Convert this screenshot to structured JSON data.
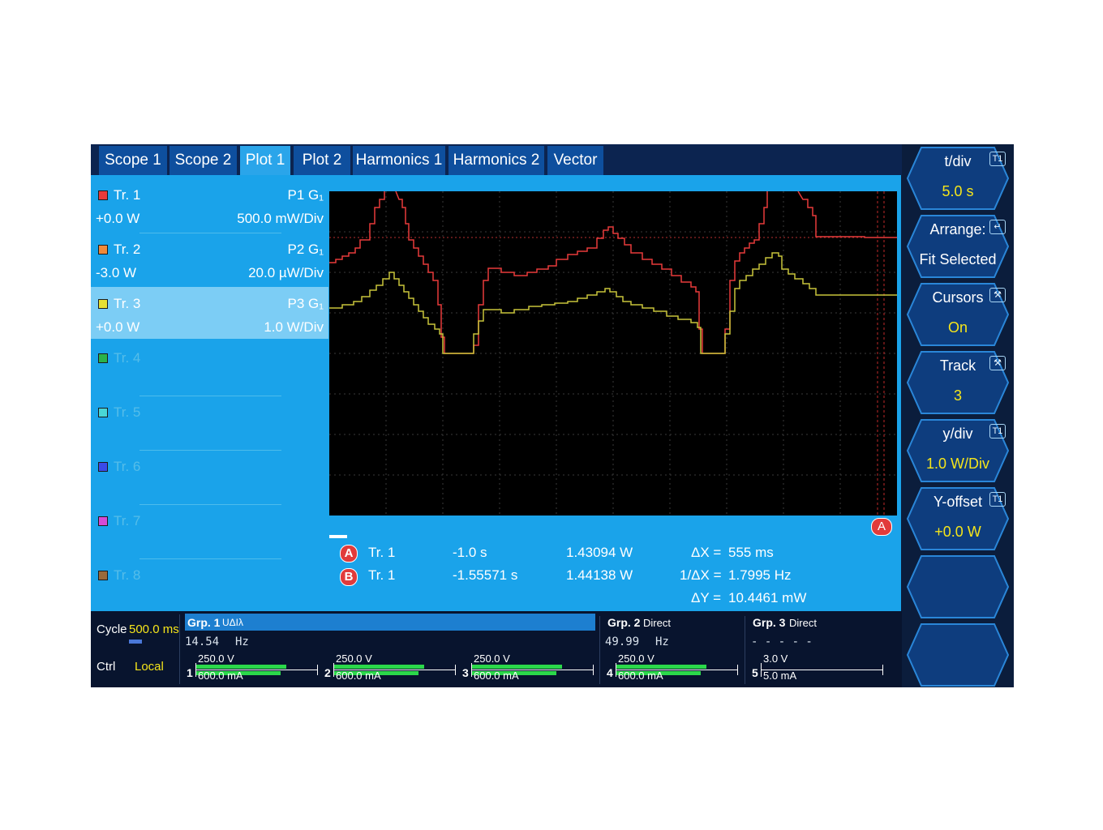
{
  "tabs": [
    "Scope 1",
    "Scope 2",
    "Plot 1",
    "Plot 2",
    "Harmonics 1",
    "Harmonics 2",
    "Vector"
  ],
  "active_tab": "Plot 1",
  "traces": [
    {
      "name": "Tr. 1",
      "color": "#e83a3a",
      "source": "P1 G₁",
      "value": "+0.0 W",
      "scale": "500.0 mW/Div"
    },
    {
      "name": "Tr. 2",
      "color": "#f08a3a",
      "source": "P2 G₁",
      "value": "-3.0 W",
      "scale": "20.0 µW/Div"
    },
    {
      "name": "Tr. 3",
      "color": "#e6e033",
      "source": "P3 G₁",
      "value": "+0.0 W",
      "scale": "1.0 W/Div"
    },
    {
      "name": "Tr. 4",
      "color": "#2ab24a"
    },
    {
      "name": "Tr. 5",
      "color": "#49d6d6"
    },
    {
      "name": "Tr. 6",
      "color": "#3a4be8"
    },
    {
      "name": "Tr. 7",
      "color": "#d64ad6"
    },
    {
      "name": "Tr. 8",
      "color": "#9a6a3a"
    }
  ],
  "cursors": {
    "rows": [
      {
        "marker": "A",
        "trace": "Tr. 1",
        "time": "-1.0 s",
        "value": "1.43094 W"
      },
      {
        "marker": "B",
        "trace": "Tr. 1",
        "time": "-1.55571 s",
        "value": "1.44138 W"
      }
    ],
    "dx_label": "ΔX =",
    "dx": "555 ms",
    "inv_dx_label": "1/ΔX =",
    "inv_dx": "1.7995 Hz",
    "dy_label": "ΔY =",
    "dy": "10.4461 mW",
    "plot_marker": "A"
  },
  "softkeys": [
    {
      "title": "t/div",
      "value": "5.0 s",
      "icon": "T1"
    },
    {
      "title": "Arrange:",
      "value": "Fit Selected",
      "icon": "enter"
    },
    {
      "title": "Cursors",
      "value": "On",
      "icon": "tools"
    },
    {
      "title": "Track",
      "value": "3",
      "icon": "tools"
    },
    {
      "title": "y/div",
      "value": "1.0 W/Div",
      "icon": "T1"
    },
    {
      "title": "Y-offset",
      "value": "+0.0 W",
      "icon": "T1"
    },
    {
      "title": "",
      "value": ""
    },
    {
      "title": "",
      "value": ""
    }
  ],
  "status": {
    "cycle_label": "Cycle",
    "cycle": "500.0 ms",
    "ctrl_label": "Ctrl",
    "ctrl": "Local",
    "groups": [
      {
        "label": "Grp. 1",
        "mode": "UΔIλ",
        "freq": "14.54",
        "unit": "Hz"
      },
      {
        "label": "Grp. 2",
        "mode": "Direct",
        "freq": "49.99",
        "unit": "Hz"
      },
      {
        "label": "Grp. 3",
        "mode": "Direct",
        "freq": "- - - - -"
      }
    ],
    "channels": [
      {
        "num": "1",
        "v": "250.0 V",
        "a": "600.0 mA",
        "fill1": 0.75,
        "fill2": 0.7
      },
      {
        "num": "2",
        "v": "250.0 V",
        "a": "600.0 mA",
        "fill1": 0.75,
        "fill2": 0.7
      },
      {
        "num": "3",
        "v": "250.0 V",
        "a": "600.0 mA",
        "fill1": 0.75,
        "fill2": 0.7
      },
      {
        "num": "4",
        "v": "250.0 V",
        "a": "600.0 mA",
        "fill1": 0.75,
        "fill2": 0.7
      },
      {
        "num": "5",
        "v": "3.0 V",
        "a": "5.0 mA",
        "fill1": 0.0,
        "fill2": 0.0
      }
    ]
  },
  "colors": {
    "panel": "#1aa3ea",
    "accent_yellow": "#f5e51a",
    "trace_red": "#e83a3a",
    "trace_yellow": "#c8c43a"
  }
}
